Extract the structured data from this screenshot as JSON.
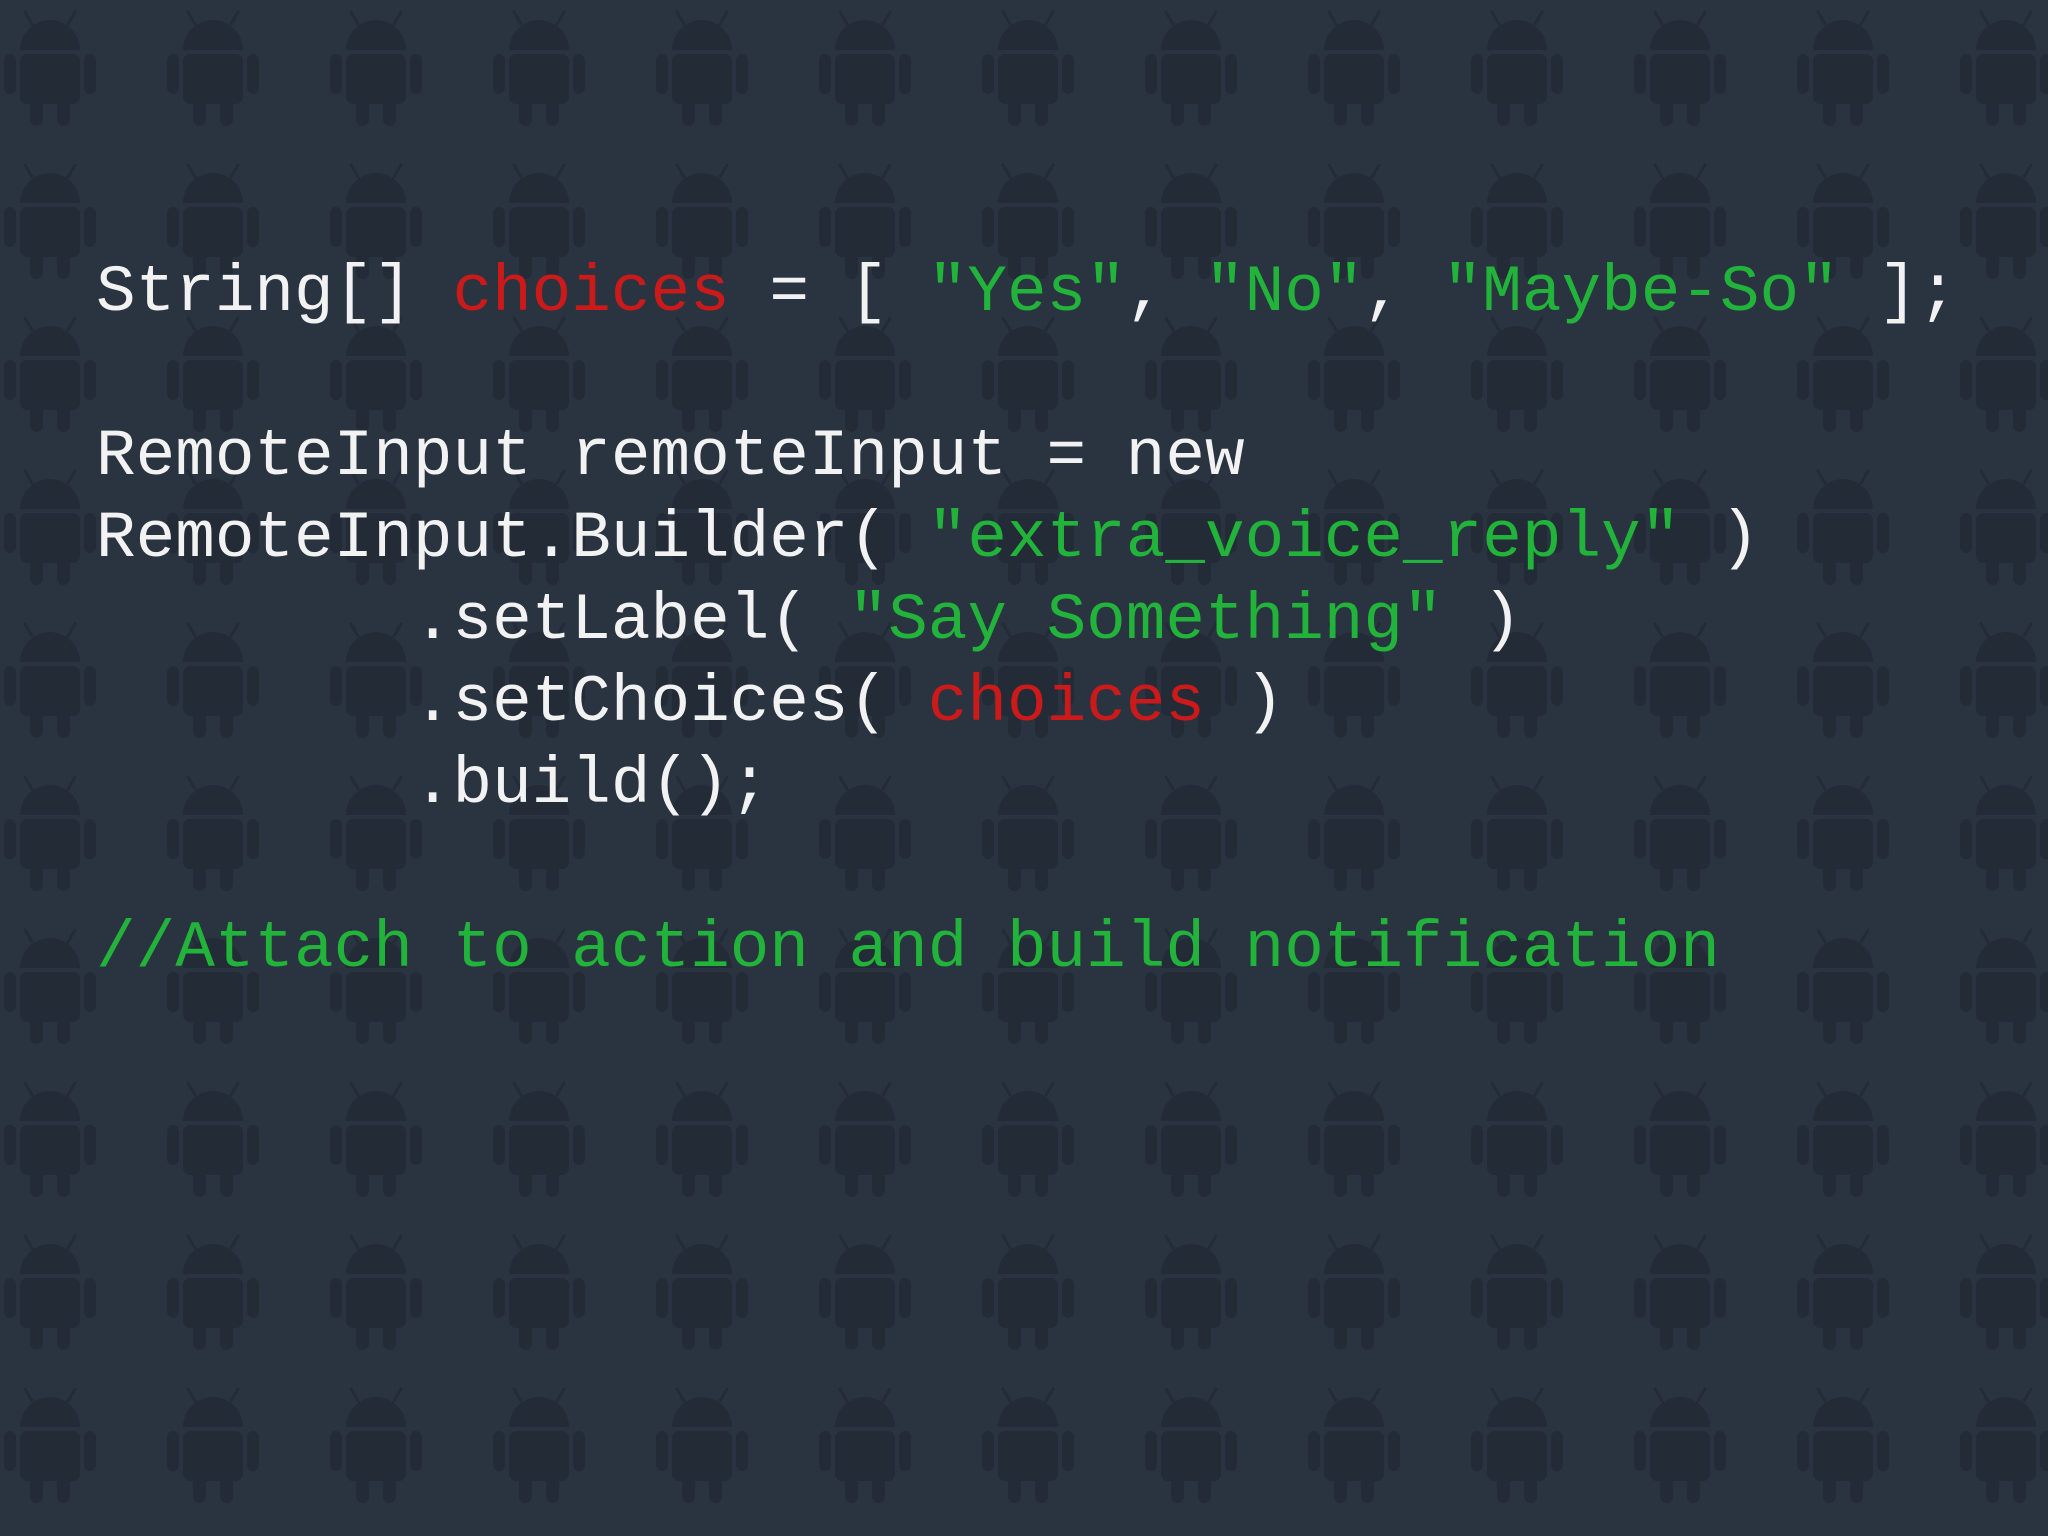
{
  "colors": {
    "background": "#2a3441",
    "pattern": "#222b36",
    "plain": "#f2f2f2",
    "variable": "#cc1a1a",
    "string": "#22b33a",
    "comment": "#22b33a"
  },
  "background_pattern_icon": "android-robot-icon",
  "code_lines": [
    {
      "name": "code-line-choices-declaration",
      "tokens": [
        {
          "kind": "plain",
          "text": "String[] "
        },
        {
          "kind": "variable",
          "text": "choices"
        },
        {
          "kind": "plain",
          "text": " = [ "
        },
        {
          "kind": "string",
          "text": "\"Yes\""
        },
        {
          "kind": "plain",
          "text": ", "
        },
        {
          "kind": "string",
          "text": "\"No\""
        },
        {
          "kind": "plain",
          "text": ", "
        },
        {
          "kind": "string",
          "text": "\"Maybe-So\""
        },
        {
          "kind": "plain",
          "text": " ];"
        }
      ]
    },
    {
      "name": "code-line-blank",
      "tokens": []
    },
    {
      "name": "code-line-remote-input-declaration",
      "tokens": [
        {
          "kind": "plain",
          "text": "RemoteInput remoteInput = new"
        }
      ]
    },
    {
      "name": "code-line-builder",
      "tokens": [
        {
          "kind": "plain",
          "text": "RemoteInput.Builder( "
        },
        {
          "kind": "string",
          "text": "\"extra_voice_reply\""
        },
        {
          "kind": "plain",
          "text": " )"
        }
      ]
    },
    {
      "name": "code-line-set-label",
      "tokens": [
        {
          "kind": "plain",
          "text": "        .setLabel( "
        },
        {
          "kind": "string",
          "text": "\"Say Something\""
        },
        {
          "kind": "plain",
          "text": " )"
        }
      ]
    },
    {
      "name": "code-line-set-choices",
      "tokens": [
        {
          "kind": "plain",
          "text": "        .setChoices( "
        },
        {
          "kind": "variable",
          "text": "choices"
        },
        {
          "kind": "plain",
          "text": " )"
        }
      ]
    },
    {
      "name": "code-line-build",
      "tokens": [
        {
          "kind": "plain",
          "text": "        .build();"
        }
      ]
    },
    {
      "name": "code-line-blank",
      "tokens": []
    },
    {
      "name": "code-line-comment",
      "tokens": [
        {
          "kind": "comment",
          "text": "//Attach to action and build notification"
        }
      ]
    }
  ]
}
